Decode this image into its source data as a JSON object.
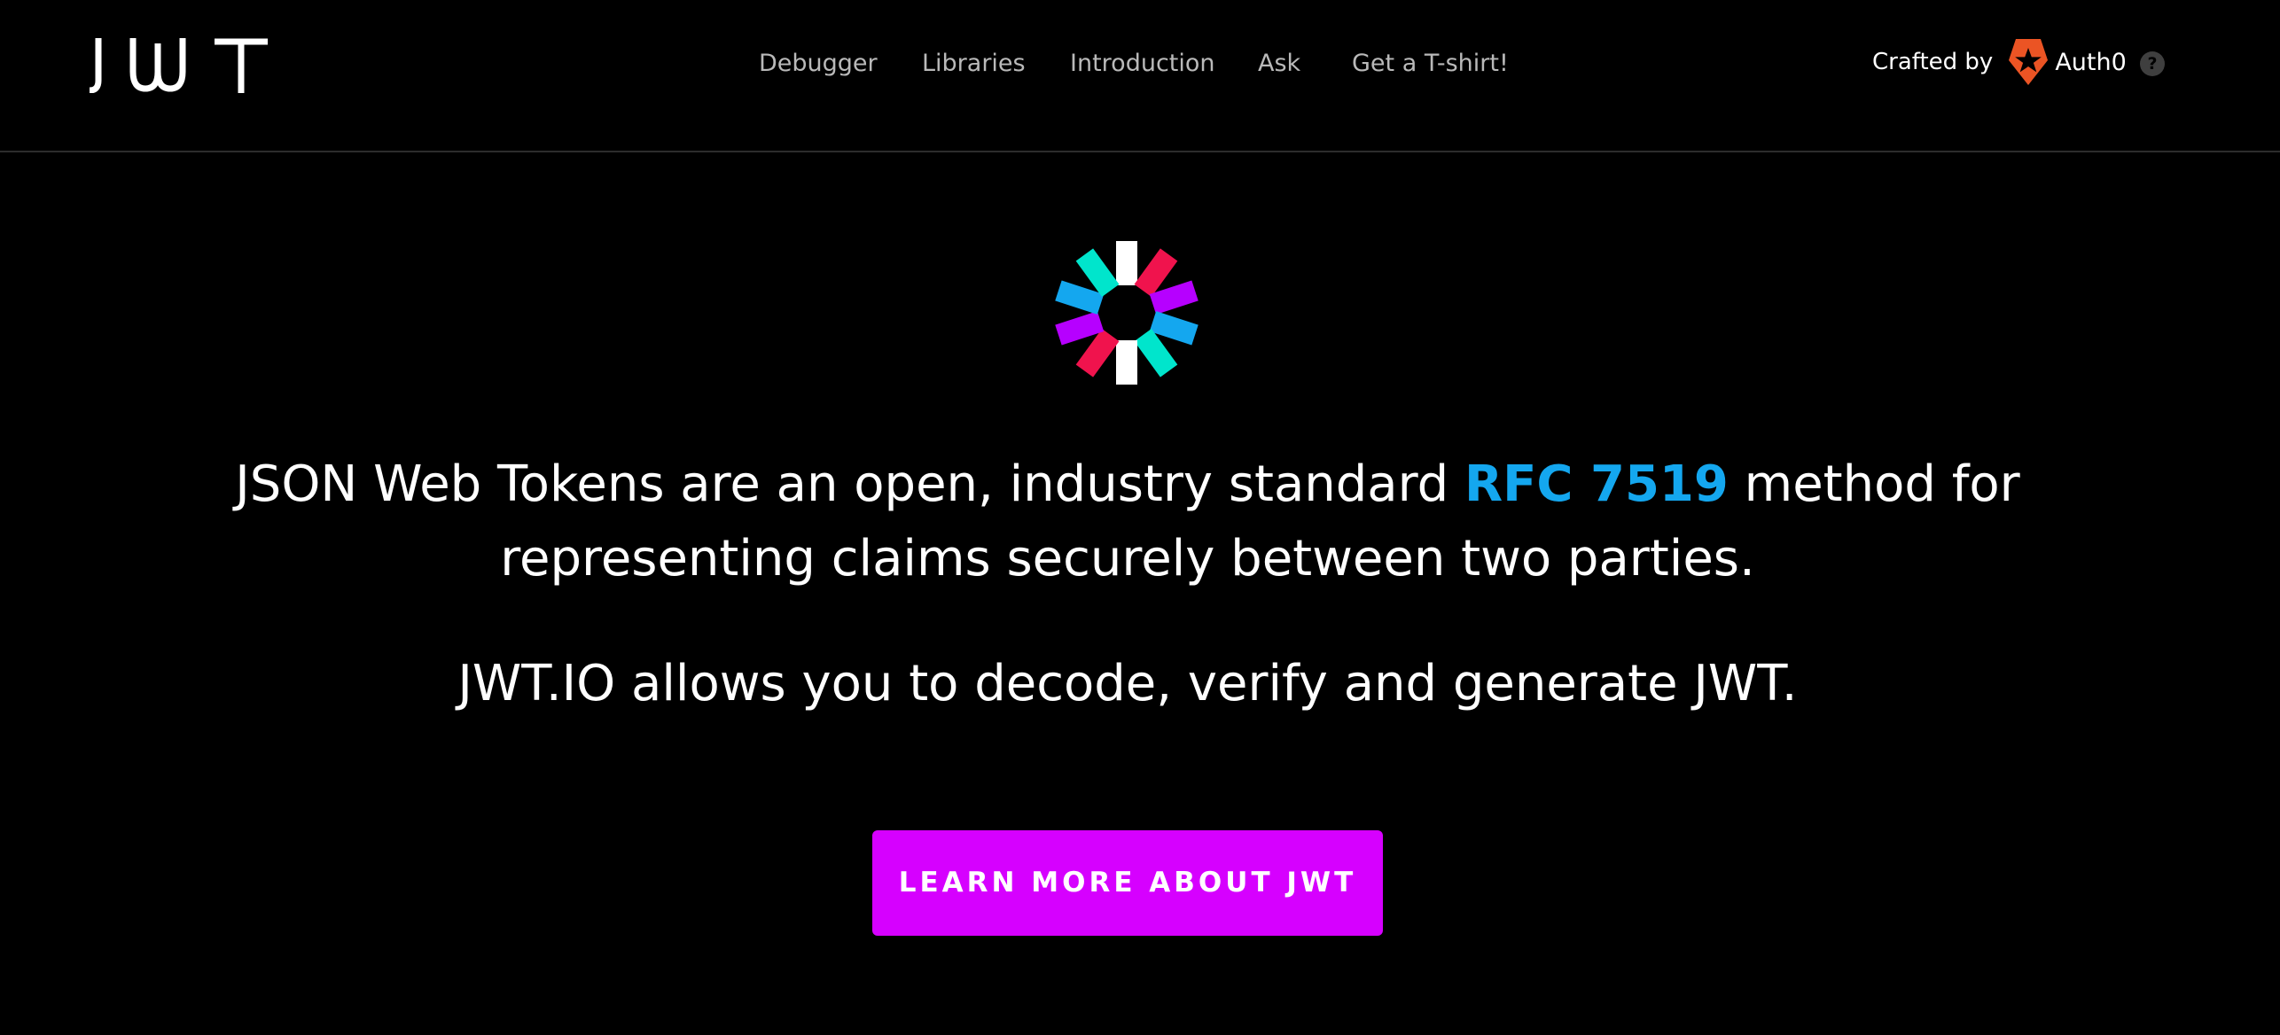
{
  "header": {
    "brand": "JWT",
    "nav": [
      {
        "label": "Debugger"
      },
      {
        "label": "Libraries"
      },
      {
        "label": "Introduction"
      },
      {
        "label": "Ask"
      },
      {
        "label": "Get a T-shirt!"
      }
    ],
    "crafted_by_label": "Crafted by",
    "crafted_by_brand": "Auth0",
    "help_symbol": "?"
  },
  "hero": {
    "text_before_link": "JSON Web Tokens are an open, industry standard ",
    "rfc_link": "RFC 7519",
    "text_after_link": " method for representing claims securely between two parties.",
    "subtitle": "JWT.IO allows you to decode, verify and generate JWT.",
    "cta_label": "LEARN MORE ABOUT JWT"
  },
  "icons": {
    "brand": "jwt-wordmark-icon",
    "emblem": "jwt-pinwheel-logo-icon",
    "auth0": "auth0-shield-icon",
    "help": "question-circle-icon"
  },
  "colors": {
    "background": "#000000",
    "nav_text": "#b9b9b9",
    "link_blue": "#14a7ef",
    "cta_magenta": "#d600ff",
    "emblem_cyan": "#00e5cc",
    "emblem_pink": "#f0134d",
    "emblem_purple": "#b600ff",
    "emblem_blue": "#14a7ef",
    "auth0_red": "#eb5424"
  }
}
